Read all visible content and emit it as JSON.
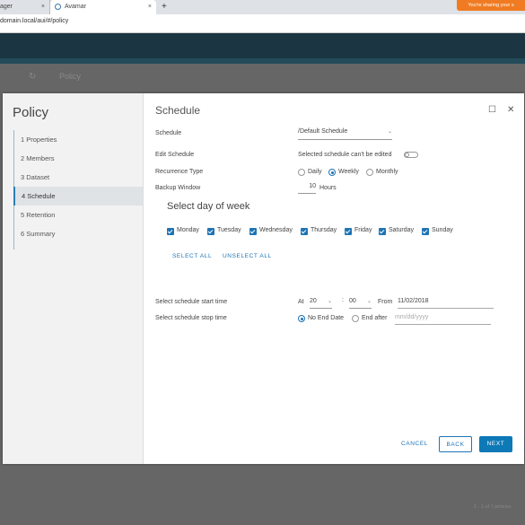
{
  "browser": {
    "tabs": [
      {
        "label": "ager",
        "close": "×"
      },
      {
        "label": "Avamar",
        "close": "×"
      }
    ],
    "new_tab": "+",
    "share_banner": "You're sharing your s",
    "url": "domain.local/aui/#/policy"
  },
  "background": {
    "refresh": "↻",
    "page_title": "Policy",
    "pager": "1 - 1 of 1 policies"
  },
  "modal": {
    "nav_title": "Policy",
    "steps": [
      {
        "label": "1 Properties"
      },
      {
        "label": "2 Members"
      },
      {
        "label": "3 Dataset"
      },
      {
        "label": "4 Schedule"
      },
      {
        "label": "5 Retention"
      },
      {
        "label": "6 Summary"
      }
    ],
    "active_step": 3,
    "title": "Schedule",
    "maximize": "☐",
    "close": "✕",
    "schedule": {
      "label": "Schedule",
      "value": "/Default Schedule",
      "chevron": "⌄"
    },
    "edit_schedule": {
      "label": "Edit Schedule",
      "note": "Selected schedule can't be edited",
      "toggle_on": false
    },
    "recurrence": {
      "label": "Recurrence Type",
      "options": [
        "Daily",
        "Weekly",
        "Monthly"
      ],
      "selected": "Weekly"
    },
    "backup_window": {
      "label": "Backup Window",
      "value": "10",
      "unit": "Hours"
    },
    "day_title": "Select day of week",
    "days": [
      {
        "label": "Monday",
        "checked": true
      },
      {
        "label": "Tuesday",
        "checked": true
      },
      {
        "label": "Wednesday",
        "checked": true
      },
      {
        "label": "Thursday",
        "checked": true
      },
      {
        "label": "Friday",
        "checked": true
      },
      {
        "label": "Saturday",
        "checked": true
      },
      {
        "label": "Sunday",
        "checked": true
      }
    ],
    "select_all": "SELECT ALL",
    "unselect_all": "UNSELECT ALL",
    "start_time": {
      "label": "Select schedule start time",
      "at": "At",
      "hour": "20",
      "colon": ":",
      "minute": "00",
      "from": "From",
      "date": "11/02/2018"
    },
    "stop_time": {
      "label": "Select schedule stop time",
      "no_end": "No End Date",
      "end_after": "End after",
      "date_placeholder": "mm/dd/yyyy",
      "selected": "No End Date"
    },
    "buttons": {
      "cancel": "CANCEL",
      "back": "BACK",
      "next": "NEXT"
    }
  },
  "colors": {
    "accent": "#1e74b5",
    "primary_button": "#0d79b7",
    "app_header": "#1b3642",
    "share_banner": "#f07b22"
  }
}
